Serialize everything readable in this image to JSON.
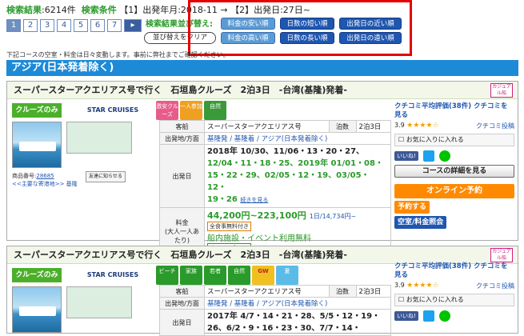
{
  "header": {
    "result_label": "検索結果",
    "result_count": ":6214件",
    "cond_label": "検索条件",
    "cond_text": "【1】出発年月:2018-11 → 【2】出発日:27日~"
  },
  "pager": [
    "1",
    "2",
    "3",
    "4",
    "5",
    "6",
    "7",
    "▸"
  ],
  "sort": {
    "label": "検索結果並び替え:",
    "clear": "並び替えをクリア",
    "buttons": [
      "料金の安い順",
      "日数の短い順",
      "出発日の近い順",
      "料金の高い順",
      "日数の長い順",
      "出発日の遠い順"
    ]
  },
  "notice": "下記コースの空室・料金は日々変動します。事前に弊社までご確認ください。",
  "region": "アジア(日本発着除く)",
  "card1": {
    "title": "スーパースターアクエリアス号で行く　石垣島クルーズ　2泊3日　-台湾(基隆)発着-",
    "casual": "カジュアル船",
    "cruise_only": "クルーズのみ",
    "logo": "STAR CRUISES",
    "badges": [
      "激安クルーズ",
      "一人参加",
      "自然"
    ],
    "friend": "友達に知らせる",
    "prod_label": "商品番号:",
    "prod_num": "28685",
    "ports": "<<主要な寄港地>> 基隆",
    "ship_k": "客船",
    "ship_v": "スーパースターアクエリアス号",
    "nights_k": "泊数",
    "nights_v": "2泊3日",
    "area_k": "出発地/方面",
    "area_v": "基隆発 / 基隆着 / アジア(日本発着除く)",
    "dep_k": "出発日",
    "dep_1": "2018年 10/30、11/06・13・20・27、",
    "dep_2": "12/04・11・18・25、2019年 01/01・08・",
    "dep_3": "15・22・29、02/05・12・19、03/05・12・",
    "dep_4": "19・26",
    "dep_more": "続きを見る",
    "price_k": "料金\n(大人一人あたり)",
    "price": "44,200円~223,100円",
    "per_day": "1日/14,734円~",
    "allmeal": "全食事無料付き",
    "onboard": "船内施設・イベント利用無料",
    "cotag": "クルーズのみ",
    "avg": "クチコミ平均評価(38件) クチコミを見る",
    "rating": "3.9",
    "post": "クチコミ投稿",
    "fav": "お気に入りに入れる",
    "like": "いいね!",
    "detail": "コースの詳細を見る",
    "online": "オンライン予約",
    "reserve": "予約する",
    "inquire": "空室/料金照会"
  },
  "card2": {
    "title": "スーパースターアクエリアス号で行く　石垣島クルーズ　2泊3日　-台湾(基隆)発着-",
    "casual": "カジュアル船",
    "cruise_only": "クルーズのみ",
    "logo": "STAR CRUISES",
    "badges": [
      "ビーチ",
      "家族",
      "若者",
      "自然",
      "GW",
      "夏"
    ],
    "ship_k": "客船",
    "ship_v": "スーパースターアクエリアス号",
    "nights_k": "泊数",
    "nights_v": "2泊3日",
    "area_k": "出発地/方面",
    "area_v": "基隆発 / 基隆着 / アジア(日本発着除く)",
    "dep_k": "出発日",
    "dep_1": "2017年 4/7・14・21・28、5/5・12・19・",
    "dep_2": "26、6/2・9・16・23・30、7/7・14・",
    "avg": "クチコミ平均評価(38件) クチコミを見る",
    "rating": "3.9",
    "post": "クチコミ投稿",
    "fav": "お気に入りに入れる",
    "like": "いいね!"
  }
}
